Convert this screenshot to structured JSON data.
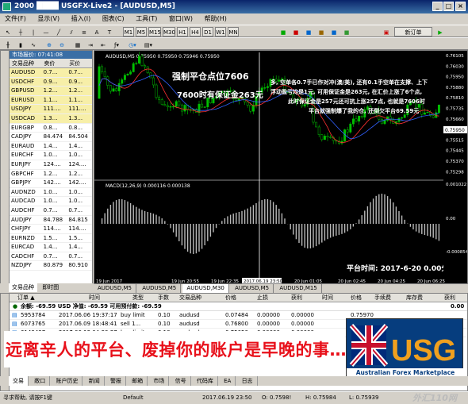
{
  "title": "2000 ████ USGFX-Live2 - [AUDUSD,M5]",
  "menu": [
    "文件(F)",
    "显示(V)",
    "插入(I)",
    "图表(C)",
    "工具(T)",
    "窗口(W)",
    "帮助(H)"
  ],
  "toolbar": {
    "periods": [
      "M1",
      "M5",
      "M15",
      "M30",
      "H1",
      "H4",
      "D1",
      "W1",
      "MN"
    ],
    "new_order": "新订单"
  },
  "market_watch": {
    "header": "市场报价: 07:41:08",
    "columns": [
      "交易品种",
      "卖价",
      "买价"
    ],
    "rows": [
      {
        "sym": "AUDUSD",
        "bid": "0.7...",
        "ask": "0.7...",
        "hl": true
      },
      {
        "sym": "USDCHF",
        "bid": "0.9...",
        "ask": "0.9...",
        "hl": true
      },
      {
        "sym": "GBPUSD",
        "bid": "1.2...",
        "ask": "1.2...",
        "hl": true
      },
      {
        "sym": "EURUSD",
        "bid": "1.1...",
        "ask": "1.1...",
        "hl": true
      },
      {
        "sym": "USDJPY",
        "bid": "111....",
        "ask": "111....",
        "hl": true
      },
      {
        "sym": "USDCAD",
        "bid": "1.3...",
        "ask": "1.3...",
        "hl": true
      },
      {
        "sym": "EURGBP",
        "bid": "0.8...",
        "ask": "0.8...",
        "hl": false
      },
      {
        "sym": "CADJPY",
        "bid": "84.474",
        "ask": "84.504",
        "hl": false
      },
      {
        "sym": "EURAUD",
        "bid": "1.4...",
        "ask": "1.4...",
        "hl": false
      },
      {
        "sym": "EURCHF",
        "bid": "1.0...",
        "ask": "1.0...",
        "hl": false
      },
      {
        "sym": "EURJPY",
        "bid": "124....",
        "ask": "124....",
        "hl": false
      },
      {
        "sym": "GBPCHF",
        "bid": "1.2...",
        "ask": "1.2...",
        "hl": false
      },
      {
        "sym": "GBPJPY",
        "bid": "142....",
        "ask": "142....",
        "hl": false
      },
      {
        "sym": "AUDNZD",
        "bid": "1.0...",
        "ask": "1.0...",
        "hl": false
      },
      {
        "sym": "AUDCAD",
        "bid": "1.0...",
        "ask": "1.0...",
        "hl": false
      },
      {
        "sym": "AUDCHF",
        "bid": "0.7...",
        "ask": "0.7...",
        "hl": false
      },
      {
        "sym": "AUDJPY",
        "bid": "84.788",
        "ask": "84.815",
        "hl": false
      },
      {
        "sym": "CHFJPY",
        "bid": "114....",
        "ask": "114....",
        "hl": false
      },
      {
        "sym": "EURNZD",
        "bid": "1.5...",
        "ask": "1.5...",
        "hl": false
      },
      {
        "sym": "EURCAD",
        "bid": "1.4...",
        "ask": "1.4...",
        "hl": false
      },
      {
        "sym": "CADCHF",
        "bid": "0.7...",
        "ask": "0.7...",
        "hl": false
      },
      {
        "sym": "NZDJPY",
        "bid": "80.879",
        "ask": "80.910",
        "hl": false
      }
    ],
    "tabs": [
      "交易品种",
      "即时图"
    ]
  },
  "chart": {
    "header": "AUDUSD,M5  0.75950 0.75950 0.75946 0.75950",
    "macd_label": "MACD(12,26,9) 0.000116 0.000138",
    "annotation_stop": "强制平仓点位7606",
    "annotation_margin": "7600时有保证金263元",
    "annotation_story": [
      "多, 空单各0.7手已作对冲(澳/美), 还有0.1手空单在支撑、上下",
      "浮动盈亏均是1元, 可用保证金是263元, 在汇价上涨了6个点,",
      "此时保证金是257元还可抗上涨257点, 也就是7606时",
      "平台就强制爆了我的仓, 还倒欠平台69.59元"
    ],
    "annotation_time": "平台时间: 2017-6-20  0.00分时",
    "price_ticks": [
      "0.76105",
      "0.76030",
      "0.75950",
      "0.75880",
      "0.75810",
      "0.75735",
      "0.75660",
      "0.75588",
      "0.75515",
      "0.75445",
      "0.75370",
      "0.75298"
    ],
    "current_price": "0.75950",
    "macd_ticks": [
      "0.001022",
      "0.00",
      "-0.000854"
    ],
    "time_ticks": [
      "19 Jun 2017",
      "19 Jun 20:55",
      "19 Jun 22:35",
      "2017.06.19 23:50",
      "20 Jun 01:05",
      "20 Jun 02:45",
      "20 Jun 04:25",
      "20 Jun 06:25"
    ],
    "tabs": [
      "AUDUSD,M5",
      "AUDUSD,M5",
      "AUDUSD,M30",
      "AUDUSD,M5",
      "AUDUSD,M15"
    ],
    "active_tab": 2
  },
  "terminal": {
    "columns": [
      "订单 ▲",
      "时间",
      "类型",
      "手数",
      "交易品种",
      "价格",
      "止损",
      "获利",
      "时间",
      "价格",
      "手续费",
      "库存费",
      "获利"
    ],
    "balance": "余额: -69.59 USD  净值: -69.59  可用预付款: -69.59",
    "balance_value": "0.00",
    "orders": [
      {
        "id": "5953784",
        "time": "2017.06.06 19:37:17",
        "type": "buy limit",
        "lots": "0.10",
        "sym": "audusd",
        "price": "0.07484",
        "sl": "0.00000",
        "tp": "0.00000",
        "cur": "0.75970"
      },
      {
        "id": "6073765",
        "time": "2017.06.09 18:48:41",
        "type": "sell 1...",
        "lots": "0.10",
        "sym": "audusd",
        "price": "0.76800",
        "sl": "0.00000",
        "tp": "0.00000",
        "cur": "0.75950"
      },
      {
        "id": "6143437",
        "time": "2017.06.13 04:30:27",
        "type": "buy limit",
        "lots": "0.10",
        "sym": "audusd",
        "price": "0.75050",
        "sl": "0.00000",
        "tp": "0.00000",
        "cur": "0.75970"
      }
    ],
    "banner": "远离辛人的平台、废掉你的账户是早晚的事……!",
    "tabs": [
      "交易",
      "敞口",
      "账户历史",
      "新闻",
      "警报",
      "邮箱",
      "市场",
      "信号",
      "代码库",
      "EA",
      "日志"
    ]
  },
  "usg": {
    "logo_text": "USG",
    "tagline": "Australian Forex Marketplace"
  },
  "status": {
    "help": "寻求帮助, 请按F1键",
    "profile": "Default",
    "datetime": "2017.06.19 23:50",
    "open": "O: 0.7598!",
    "high": "H: 0.75984",
    "low": "L: 0.75939",
    "watermark": "外汇110网"
  },
  "colors": {
    "bull": "#00c000",
    "bear": "#00c000",
    "stop_line": "#ffffff",
    "annotation": "#ffffff",
    "banner": "#e8101a"
  }
}
